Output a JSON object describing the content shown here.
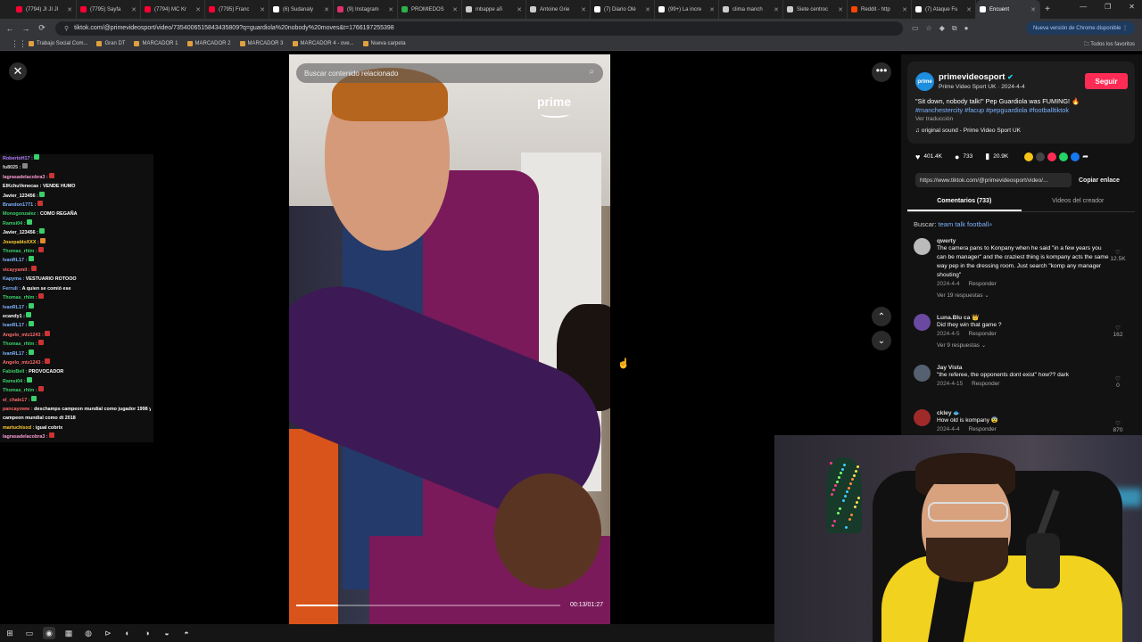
{
  "browser": {
    "tabs": [
      {
        "label": "(7794) JI JI JI",
        "color": "#ff0033",
        "active": false
      },
      {
        "label": "(7795) Sayfa",
        "color": "#ff0033",
        "active": false
      },
      {
        "label": "(7794) MC Kr",
        "color": "#ff0033",
        "active": false
      },
      {
        "label": "(7795) Franc",
        "color": "#ff0033",
        "active": false
      },
      {
        "label": "(6) Sudanaly",
        "color": "#ffffff",
        "active": false
      },
      {
        "label": "(9) Instagram",
        "color": "#e1306c",
        "active": false
      },
      {
        "label": "PROMIEDOS",
        "color": "#2bb34a",
        "active": false
      },
      {
        "label": "mbappe añ",
        "color": "#cccccc",
        "active": false
      },
      {
        "label": "Antoine Grie",
        "color": "#cccccc",
        "active": false
      },
      {
        "label": "(7) Diario Olé",
        "color": "#ffffff",
        "active": false
      },
      {
        "label": "(99+) La incre",
        "color": "#ffffff",
        "active": false
      },
      {
        "label": "clima manch",
        "color": "#cccccc",
        "active": false
      },
      {
        "label": "Siete centroc",
        "color": "#cccccc",
        "active": false
      },
      {
        "label": "Reddit - http",
        "color": "#ff4500",
        "active": false
      },
      {
        "label": "(7) Ataque Fu",
        "color": "#ffffff",
        "active": false
      },
      {
        "label": "Encuent",
        "color": "#ffffff",
        "active": true
      }
    ],
    "url": "tiktok.com/@primevideosport/video/7354006515843435809?q=guardiola%20nobody%20moves&t=1766197255398",
    "update_label": "Nueva versión de Chrome disponible",
    "bookmarks": [
      "Trabajo Social Com...",
      "Gran DT",
      "MARCADOR 1",
      "MARCADOR 2",
      "MARCADOR 3",
      "MARCADOR 4 - ove...",
      "Nueva carpeta"
    ],
    "all_bookmarks": "Todos los favoritos"
  },
  "chat": [
    {
      "user": "RobertoH17 :",
      "color": "#b27cff",
      "msg": "",
      "emote": "#3ad06a"
    },
    {
      "user": "fu8025 :",
      "color": "#dddddd",
      "msg": "",
      "emote": "#888888"
    },
    {
      "user": "lagrasadelacobra3 :",
      "color": "#ff9ed8",
      "msg": "",
      "emote": "#c33"
    },
    {
      "user": "ElKchuVenecas :",
      "color": "#ffffff",
      "msg": "VENDE HUMO",
      "emote": ""
    },
    {
      "user": "Javier_123456 :",
      "color": "#ffffff",
      "msg": "",
      "emote": "#3ad06a"
    },
    {
      "user": "Brandon1771 :",
      "color": "#7db3ff",
      "msg": "",
      "emote": "#c33"
    },
    {
      "user": "Monogonzalez :",
      "color": "#3ad06a",
      "msg": "COMO REGAÑA",
      "emote": ""
    },
    {
      "user": "Ramsi04 :",
      "color": "#3ad06a",
      "msg": "",
      "emote": "#3ad06a"
    },
    {
      "user": "Javier_123456 :",
      "color": "#ffffff",
      "msg": "",
      "emote": "#3ad06a"
    },
    {
      "user": "JosepabloXXX :",
      "color": "#ffcc33",
      "msg": "",
      "emote": "#e08a2a"
    },
    {
      "user": "Thomas_rhlm :",
      "color": "#3ad06a",
      "msg": "",
      "emote": "#c33"
    },
    {
      "user": "IvanRL17 :",
      "color": "#7db3ff",
      "msg": "",
      "emote": "#3ad06a"
    },
    {
      "user": "vicayyamil :",
      "color": "#ff6a6a",
      "msg": "",
      "emote": "#c33"
    },
    {
      "user": "Kapyma :",
      "color": "#7db3ff",
      "msg": "VESTUARIO ROTOOO",
      "emote": ""
    },
    {
      "user": "Ferruli :",
      "color": "#7db3ff",
      "msg": "A quien se comió ese",
      "emote": ""
    },
    {
      "user": "Thomas_rhlm :",
      "color": "#3ad06a",
      "msg": "",
      "emote": "#c33"
    },
    {
      "user": "IvanRL17 :",
      "color": "#7db3ff",
      "msg": "",
      "emote": "#3ad06a"
    },
    {
      "user": "ecandy1 :",
      "color": "#ffffff",
      "msg": "",
      "emote": "#3ad06a"
    },
    {
      "user": "IvanRL17 :",
      "color": "#7db3ff",
      "msg": "",
      "emote": "#3ad06a"
    },
    {
      "user": "Angelo_mtz1243 :",
      "color": "#ff6a6a",
      "msg": "",
      "emote": "#c33"
    },
    {
      "user": "Thomas_rhlm :",
      "color": "#3ad06a",
      "msg": "",
      "emote": "#c33"
    },
    {
      "user": "IvanRL17 :",
      "color": "#7db3ff",
      "msg": "",
      "emote": "#3ad06a"
    },
    {
      "user": "Angelo_mtz1243 :",
      "color": "#ff6a6a",
      "msg": "",
      "emote": "#c33"
    },
    {
      "user": "FabioBell :",
      "color": "#3ad06a",
      "msg": "PROVOCADOR",
      "emote": ""
    },
    {
      "user": "Ramsi04 :",
      "color": "#3ad06a",
      "msg": "",
      "emote": "#3ad06a"
    },
    {
      "user": "Thomas_rhlm :",
      "color": "#3ad06a",
      "msg": "",
      "emote": "#c33"
    },
    {
      "user": "el_chale17 :",
      "color": "#ff6a6a",
      "msg": "",
      "emote": "#3ad06a"
    },
    {
      "user": "pancayoww :",
      "color": "#ff6a6a",
      "msg": "deschamps campeon mundial como jugador 1998 y",
      "emote": ""
    },
    {
      "user": "",
      "color": "#ffffff",
      "msg": "campeon mundial como dt 2018",
      "emote": ""
    },
    {
      "user": "martuchisxd :",
      "color": "#ffcc33",
      "msg": "igual cobrix",
      "emote": ""
    },
    {
      "user": "lagrasadelacobra3 :",
      "color": "#ff9ed8",
      "msg": "",
      "emote": "#c33"
    }
  ],
  "video": {
    "search_placeholder": "Buscar contenido relacionado",
    "brand": "prime",
    "time": "00:13/01:27",
    "progress": 0.16
  },
  "info": {
    "avatar_text": "prime",
    "username": "primevideosport",
    "subtitle": "Prime Video Sport UK · 2024-4-4",
    "follow": "Seguir",
    "caption_text": "\"Sit down, nobody talk!\" Pep Guardiola was FUMING! 🔥",
    "tags": "#manchestercity #facup #pepguardiola #footballtiktok",
    "translate": "Ver traducción",
    "sound": "♫  original sound - Prime Video Sport UK",
    "likes": "401.4K",
    "comments": "733",
    "saves": "20.9K",
    "link": "https://www.tiktok.com/@primevideosport/video/...",
    "copy": "Copiar enlace",
    "tab_comments": "Comentarios (733)",
    "tab_creator": "Videos del creador",
    "related_prefix": "Buscar:",
    "related_query": "team talk football"
  },
  "comments": [
    {
      "user": "qwerty",
      "avatar": "#bbbbbb",
      "text": "The camera pans to Konpany when he said \"in a few years you can be manager\" and the craziest thing is kompany acts the same way pep in the dressing room. Just search \"komp any manager shouting\"",
      "date": "2024-4-4",
      "reply": "Responder",
      "likes": "12.5K",
      "more": "Ver 19 respuestas ⌄"
    },
    {
      "user": "Luna.Blu ca 👑",
      "avatar": "#6a4aa0",
      "text": "Did they win that game ?",
      "date": "2024-4-5",
      "reply": "Responder",
      "likes": "162",
      "more": "Ver 9 respuestas ⌄"
    },
    {
      "user": "Jay Vista",
      "avatar": "#556070",
      "text": "\"the referee, the opponents dont exist\" how?? dark",
      "date": "2024-4-15",
      "reply": "Responder",
      "likes": "0",
      "more": ""
    },
    {
      "user": "ckley 🐟",
      "avatar": "#a02a2a",
      "text": "How old is kompany 😨",
      "date": "2024-4-4",
      "reply": "Responder",
      "likes": "870",
      "more": ""
    }
  ],
  "taskbar": [
    "⊞",
    "▭",
    "◉",
    "▦",
    "◍",
    "⊳",
    "◐",
    "◑",
    "◒",
    "◓"
  ]
}
